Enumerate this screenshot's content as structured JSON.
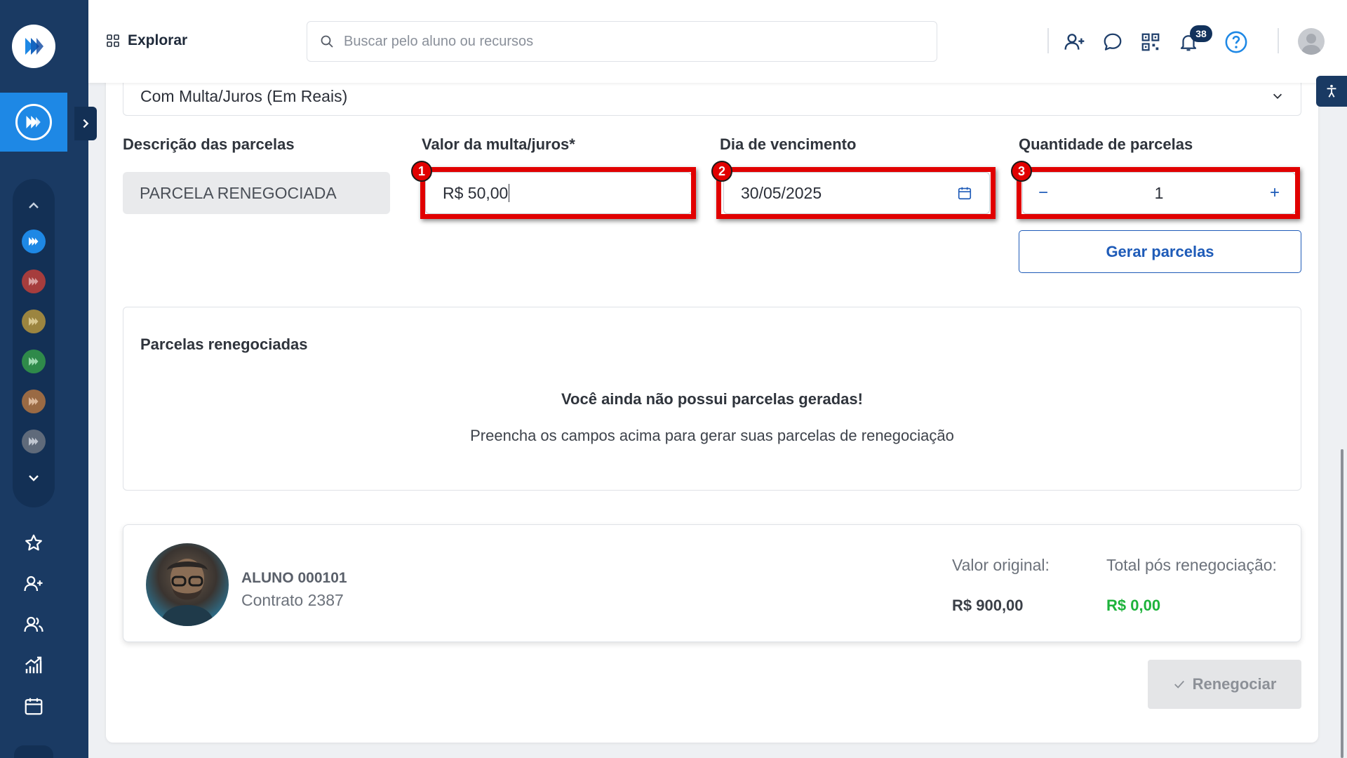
{
  "topbar": {
    "explore_label": "Explorar",
    "search_placeholder": "Buscar pelo aluno ou recursos",
    "notification_count": "38"
  },
  "form": {
    "type_select_value": "Com Multa/Juros (Em Reais)",
    "description_label": "Descrição das parcelas",
    "description_value": "PARCELA RENEGOCIADA",
    "fine_label": "Valor da multa/juros*",
    "fine_value": "R$ 50,00",
    "due_label": "Dia de vencimento",
    "due_value": "30/05/2025",
    "qty_label": "Quantidade de parcelas",
    "qty_value": "1",
    "qty_minus": "−",
    "qty_plus": "+",
    "generate_button": "Gerar parcelas"
  },
  "annotations": [
    "1",
    "2",
    "3"
  ],
  "installments": {
    "title": "Parcelas renegociadas",
    "empty_heading": "Você ainda não possui parcelas geradas!",
    "empty_text": "Preencha os campos acima para gerar suas parcelas de renegociação"
  },
  "summary": {
    "student_name": "ALUNO 000101",
    "contract": "Contrato 2387",
    "original_label": "Valor original:",
    "original_value": "R$ 900,00",
    "total_label": "Total pós renegociação:",
    "total_value": "R$ 0,00"
  },
  "actions": {
    "renegotiate_button": "Renegociar"
  },
  "colors": {
    "sidebar": "#1a3a63",
    "accent_blue": "#1e88e5",
    "highlight_red": "#e10000",
    "total_green": "#1db33b"
  }
}
